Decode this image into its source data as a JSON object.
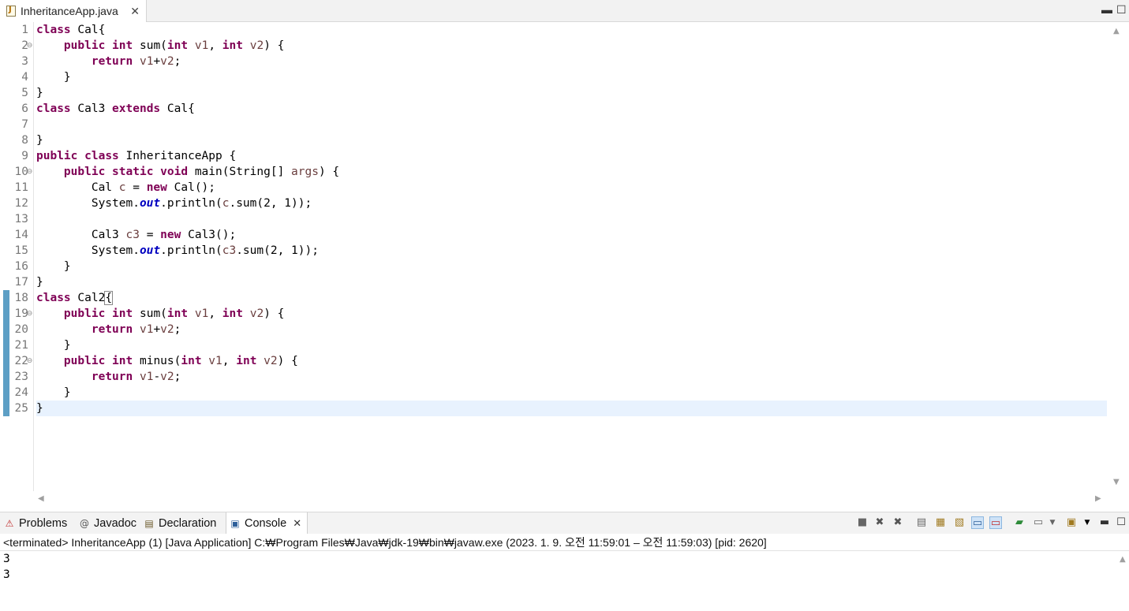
{
  "editor_tab": {
    "title": "InheritanceApp.java",
    "close": "✕"
  },
  "window_controls": {
    "minimize": "▬",
    "maximize": "☐"
  },
  "code": {
    "lines": [
      "1",
      "2",
      "3",
      "4",
      "5",
      "6",
      "7",
      "8",
      "9",
      "10",
      "11",
      "12",
      "13",
      "14",
      "15",
      "16",
      "17",
      "18",
      "19",
      "20",
      "21",
      "22",
      "23",
      "24",
      "25"
    ],
    "fold_markers": {
      "2": "⊖",
      "10": "⊖",
      "19": "⊖",
      "22": "⊖"
    },
    "current_line": 25
  },
  "panel": {
    "tabs": [
      {
        "name": "tab-problems",
        "label": "Problems",
        "icon": "problems-icon"
      },
      {
        "name": "tab-javadoc",
        "label": "Javadoc",
        "icon": "javadoc-icon"
      },
      {
        "name": "tab-declaration",
        "label": "Declaration",
        "icon": "declaration-icon"
      },
      {
        "name": "tab-console",
        "label": "Console",
        "icon": "console-icon",
        "active": true
      }
    ],
    "console_close": "✕",
    "status": "<terminated> InheritanceApp (1) [Java Application] C:₩Program Files₩Java₩jdk-19₩bin₩javaw.exe  (2023. 1. 9. 오전 11:59:01 – 오전 11:59:03) [pid: 2620]",
    "output": [
      "3",
      "3"
    ]
  },
  "colors": {
    "keyword": "#7f0055",
    "variable": "#6a3e3e",
    "static_field": "#0000c0",
    "current_line": "#e8f2fe",
    "change_ruler": "#5d9fc5"
  }
}
